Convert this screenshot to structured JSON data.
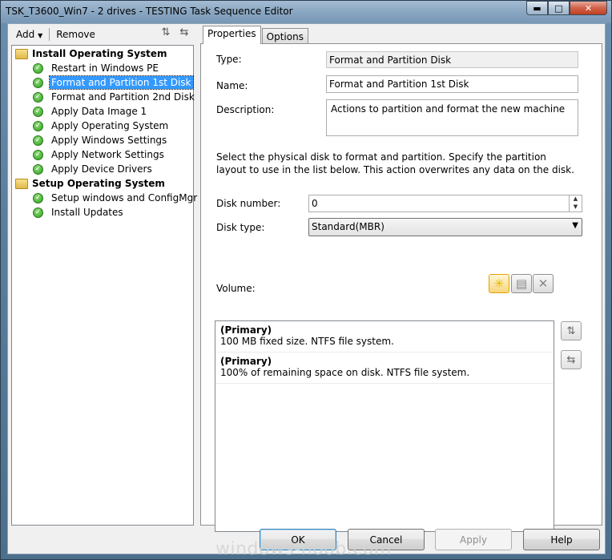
{
  "window": {
    "title": "TSK_T3600_Win7 - 2 drives - TESTING Task Sequence Editor"
  },
  "toolbar": {
    "add_label": "Add",
    "remove_label": "Remove"
  },
  "tree": {
    "groups": [
      {
        "label": "Install Operating System",
        "steps": [
          "Restart in Windows PE",
          "Format and Partition 1st Disk",
          "Format and Partition 2nd Disk",
          "Apply Data Image 1",
          "Apply Operating System",
          "Apply Windows Settings",
          "Apply Network Settings",
          "Apply Device Drivers"
        ]
      },
      {
        "label": "Setup Operating System",
        "steps": [
          "Setup windows and ConfigMgr",
          "Install Updates"
        ]
      }
    ],
    "selected": "Format and Partition 1st Disk"
  },
  "tabs": [
    {
      "label": "Properties",
      "active": true
    },
    {
      "label": "Options",
      "active": false
    }
  ],
  "properties": {
    "type_label": "Type:",
    "type_value": "Format and Partition Disk",
    "name_label": "Name:",
    "name_value": "Format and Partition 1st Disk",
    "description_label": "Description:",
    "description_value": "Actions to partition and format the new machine",
    "instructions": "Select the physical disk to format and partition. Specify the partition layout to use in the list below. This action overwrites any data on the disk.",
    "disk_number_label": "Disk number:",
    "disk_number_value": "0",
    "disk_type_label": "Disk type:",
    "disk_type_value": "Standard(MBR)",
    "volume_label": "Volume:",
    "volumes": [
      {
        "title": "(Primary)",
        "detail": "100 MB fixed size. NTFS file system."
      },
      {
        "title": "(Primary)",
        "detail": "100% of remaining space on disk. NTFS file system."
      }
    ]
  },
  "buttons": {
    "ok": "OK",
    "cancel": "Cancel",
    "apply": "Apply",
    "help": "Help"
  },
  "watermark": "windows-noob.com"
}
